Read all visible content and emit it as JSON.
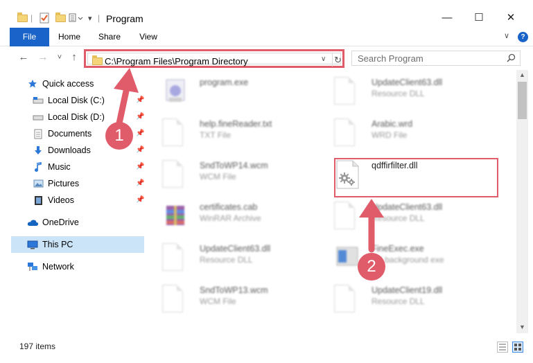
{
  "window": {
    "title": "Program",
    "minimize": "—",
    "maximize": "☐",
    "close": "✕"
  },
  "ribbon": {
    "tabs": [
      "File",
      "Home",
      "Share",
      "View"
    ],
    "help": "?",
    "collapse": "∨"
  },
  "navigation": {
    "back": "←",
    "forward": "→",
    "recent": "˅",
    "up": "↑"
  },
  "address": {
    "path": "C:\\Program Files\\Program Directory",
    "dropdown": "∨",
    "refresh": "↻"
  },
  "search": {
    "placeholder": "Search Program"
  },
  "sidebar": {
    "items": [
      {
        "label": "Quick access",
        "icon": "star-icon"
      },
      {
        "label": "Local Disk (C:)",
        "icon": "drive-icon"
      },
      {
        "label": "Local Disk (D:)",
        "icon": "drive-icon"
      },
      {
        "label": "Documents",
        "icon": "documents-icon"
      },
      {
        "label": "Downloads",
        "icon": "download-icon"
      },
      {
        "label": "Music",
        "icon": "music-icon"
      },
      {
        "label": "Pictures",
        "icon": "pictures-icon"
      },
      {
        "label": "Videos",
        "icon": "videos-icon"
      },
      {
        "label": "OneDrive",
        "icon": "cloud-icon"
      },
      {
        "label": "This PC",
        "icon": "computer-icon"
      },
      {
        "label": "Network",
        "icon": "network-icon"
      }
    ],
    "pin": "📌"
  },
  "files": [
    {
      "name": "program.exe",
      "type": ""
    },
    {
      "name": "UpdateClient63.dll",
      "type": "Resource DLL"
    },
    {
      "name": "help.fineReader.txt",
      "type": "TXT File"
    },
    {
      "name": "Arabic.wrd",
      "type": "WRD File"
    },
    {
      "name": "SndToWP14.wcm",
      "type": "WCM File"
    },
    {
      "name": "qdffirfilter.dll",
      "type": ""
    },
    {
      "name": "certificates.cab",
      "type": "WinRAR Archive"
    },
    {
      "name": "UpdateClient63.dll",
      "type": "Resource DLL"
    },
    {
      "name": "UpdateClient63.dll",
      "type": "Resource DLL"
    },
    {
      "name": "FineExec.exe",
      "type": "BY background exe"
    },
    {
      "name": "SndToWP13.wcm",
      "type": "WCM File"
    },
    {
      "name": "UpdateClient19.dll",
      "type": "Resource DLL"
    }
  ],
  "status": {
    "count": "197 items"
  },
  "annotations": {
    "marker1": "1",
    "marker2": "2",
    "color": "#e05c6a"
  }
}
